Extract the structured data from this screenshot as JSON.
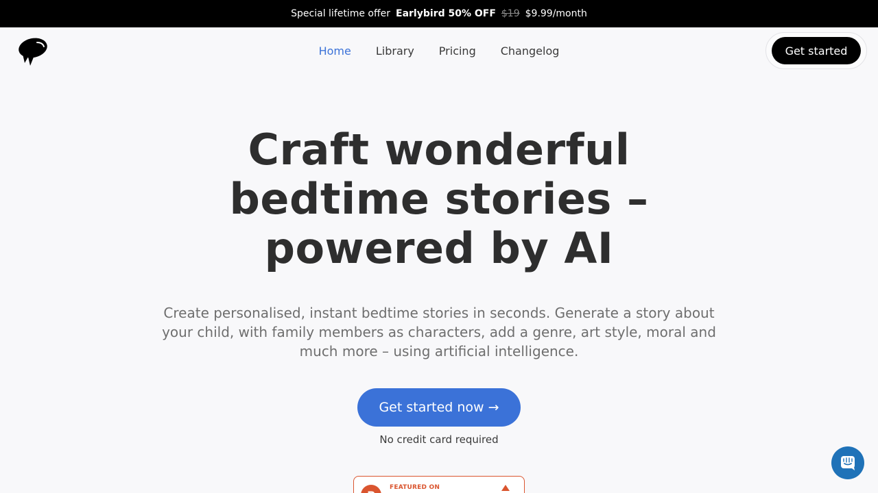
{
  "promo": {
    "offer_label": "Special lifetime offer",
    "offer_strong": "Earlybird 50% OFF",
    "old_price": "$19",
    "new_price": "$9.99/month"
  },
  "header": {
    "logo_icon": "speech-bubble-logo",
    "nav": [
      "Home",
      "Library",
      "Pricing",
      "Changelog"
    ],
    "active_nav": "Home",
    "cta_label": "Get started"
  },
  "hero": {
    "title_lines": [
      "Craft wonderful",
      "bedtime stories –",
      "powered by AI"
    ],
    "subtitle": "Create personalised, instant bedtime stories in seconds. Generate a story about your child, with family members as characters, add a genre, art style, moral and much more – using artificial intelligence.",
    "cta_label": "Get started now →",
    "cta_note": "No credit card required"
  },
  "featured": {
    "logo_letter": "P",
    "label": "FEATURED ON"
  },
  "colors": {
    "accent": "#3b72d8",
    "banner": "#000000",
    "background": "#f8f8fa",
    "featured": "#da552f",
    "chat": "#1f72b8"
  }
}
